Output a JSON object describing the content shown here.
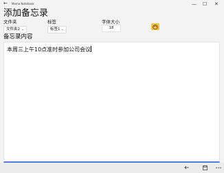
{
  "window": {
    "title": "Memo Notebook",
    "back_icon": "arrow-left-icon",
    "minimize_glyph": "—",
    "maximize_glyph": "☐",
    "close_glyph": "✕"
  },
  "page": {
    "heading": "添加备忘录"
  },
  "form": {
    "folder": {
      "label": "文件夹",
      "value": "文件夹2"
    },
    "tag": {
      "label": "标签",
      "value": "标签1"
    },
    "font_size": {
      "label": "字体大小",
      "value": "18"
    },
    "color_button_icon": "palette-icon"
  },
  "content": {
    "label": "备忘录内容",
    "text": "本周三上午10点准时参加公司会议"
  },
  "bottombar": {
    "back_icon": "arrow-left-icon",
    "save_icon": "save-icon",
    "more_icon": "more-icon"
  },
  "colors": {
    "accent": "#4f7bd9",
    "color_button": "#f5c242"
  }
}
